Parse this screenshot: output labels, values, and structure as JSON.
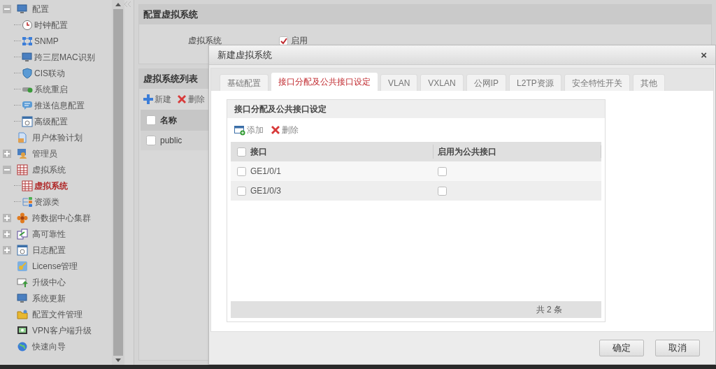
{
  "sidebar": {
    "items": [
      {
        "label": "配置",
        "kind": "monitor",
        "expanded": true,
        "children": [
          {
            "label": "时钟配置",
            "kind": "clock",
            "selected": false
          },
          {
            "label": "SNMP",
            "kind": "network",
            "selected": false
          },
          {
            "label": "跨三层MAC识别",
            "kind": "monitor",
            "selected": false
          },
          {
            "label": "CIS联动",
            "kind": "shield",
            "selected": false
          },
          {
            "label": "系统重启",
            "kind": "refresh",
            "selected": false
          },
          {
            "label": "推送信息配置",
            "kind": "chat",
            "selected": false
          },
          {
            "label": "高级配置",
            "kind": "window",
            "selected": false
          }
        ]
      },
      {
        "label": "用户体验计划",
        "kind": "doc"
      },
      {
        "label": "管理员",
        "kind": "person",
        "expanded": false
      },
      {
        "label": "虚拟系统",
        "kind": "grid",
        "expanded": true,
        "children": [
          {
            "label": "虚拟系统",
            "kind": "grid",
            "selected": true
          },
          {
            "label": "资源类",
            "kind": "list",
            "selected": false
          }
        ]
      },
      {
        "label": "跨数据中心集群",
        "kind": "flower",
        "expanded": false
      },
      {
        "label": "高可靠性",
        "kind": "swap",
        "expanded": false
      },
      {
        "label": "日志配置",
        "kind": "window",
        "expanded": false
      },
      {
        "label": "License管理",
        "kind": "key"
      },
      {
        "label": "升级中心",
        "kind": "upgrade"
      },
      {
        "label": "系统更新",
        "kind": "monitor"
      },
      {
        "label": "配置文件管理",
        "kind": "folder"
      },
      {
        "label": "VPN客户端升级",
        "kind": "screen"
      },
      {
        "label": "快速向导",
        "kind": "globe"
      }
    ]
  },
  "config_panel": {
    "title": "配置虚拟系统",
    "field_label": "虚拟系统",
    "enable_checked": true,
    "enable_label": "启用"
  },
  "list_panel": {
    "title": "虚拟系统列表",
    "toolbar": [
      "新建",
      "删除"
    ],
    "column": "名称",
    "header_checked": false,
    "rows": [
      {
        "name": "public",
        "checked": false
      }
    ]
  },
  "dialog": {
    "title": "新建虚拟系统",
    "close": "×",
    "tabs": [
      {
        "label": "基础配置",
        "selected": false
      },
      {
        "label": "接口分配及公共接口设定",
        "selected": true
      },
      {
        "label": "VLAN",
        "selected": false
      },
      {
        "label": "VXLAN",
        "selected": false
      },
      {
        "label": "公网IP",
        "selected": false
      },
      {
        "label": "L2TP资源",
        "selected": false
      },
      {
        "label": "安全特性开关",
        "selected": false
      },
      {
        "label": "其他",
        "selected": false
      }
    ],
    "section_title": "接口分配及公共接口设定",
    "toolbar": [
      "添加",
      "删除"
    ],
    "columns": [
      "接口",
      "启用为公共接口"
    ],
    "header_checked": false,
    "rows": [
      {
        "interface": "GE1/0/1",
        "checked": false,
        "public": false
      },
      {
        "interface": "GE1/0/3",
        "checked": false,
        "public": false
      }
    ],
    "footer_count": "共 2 条",
    "buttons": [
      "确定",
      "取消"
    ]
  }
}
